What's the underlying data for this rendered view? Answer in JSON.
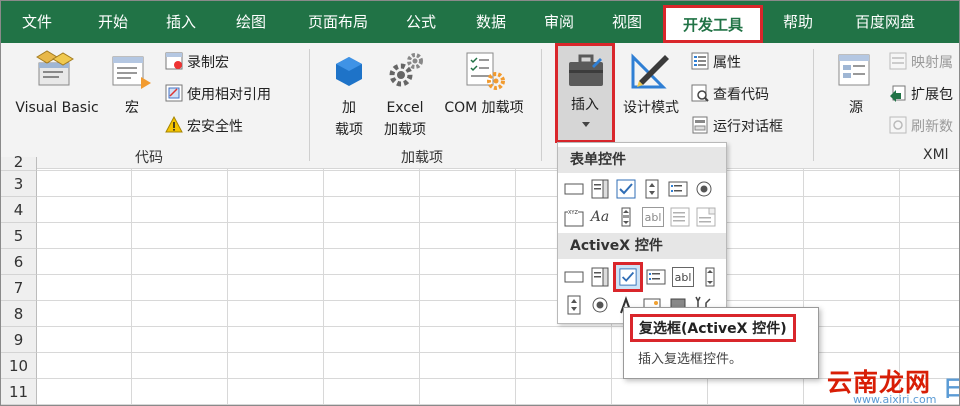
{
  "tabs": [
    {
      "label": "文件"
    },
    {
      "label": "开始"
    },
    {
      "label": "插入"
    },
    {
      "label": "绘图"
    },
    {
      "label": "页面布局"
    },
    {
      "label": "公式"
    },
    {
      "label": "数据"
    },
    {
      "label": "审阅"
    },
    {
      "label": "视图"
    },
    {
      "label": "开发工具"
    },
    {
      "label": "帮助"
    },
    {
      "label": "百度网盘"
    }
  ],
  "active_tab": "开发工具",
  "ribbon": {
    "code": {
      "visual_basic": "Visual Basic",
      "macros": "宏",
      "record_macro": "录制宏",
      "relative_refs": "使用相对引用",
      "macro_security": "宏安全性",
      "group_label": "代码"
    },
    "addins": {
      "addins_line1": "加",
      "addins_line2": "载项",
      "excel_addins_line1": "Excel",
      "excel_addins_line2": "加载项",
      "com_addins": "COM 加载项",
      "group_label": "加载项"
    },
    "controls": {
      "insert": "插入",
      "design_mode": "设计模式",
      "properties": "属性",
      "view_code": "查看代码",
      "run_dialog": "运行对话框"
    },
    "xml": {
      "source": "源",
      "map_properties": "映射属",
      "expansion_packs": "扩展包",
      "refresh_data": "刷新数",
      "group_label": "XMl"
    }
  },
  "dropdown": {
    "form_controls_header": "表单控件",
    "activex_header": "ActiveX 控件"
  },
  "tooltip": {
    "title": "复选框(ActiveX 控件)",
    "description": "插入复选框控件。"
  },
  "row_headers": [
    "2",
    "3",
    "4",
    "5",
    "6",
    "7",
    "8",
    "9",
    "10",
    "11"
  ],
  "watermark": {
    "text": "云南龙网",
    "url": "www.aixiri.com",
    "sun": "日"
  },
  "colors": {
    "excel_green": "#217346",
    "highlight_red": "#d9262b",
    "ribbon_bg": "#f3f3f3"
  }
}
